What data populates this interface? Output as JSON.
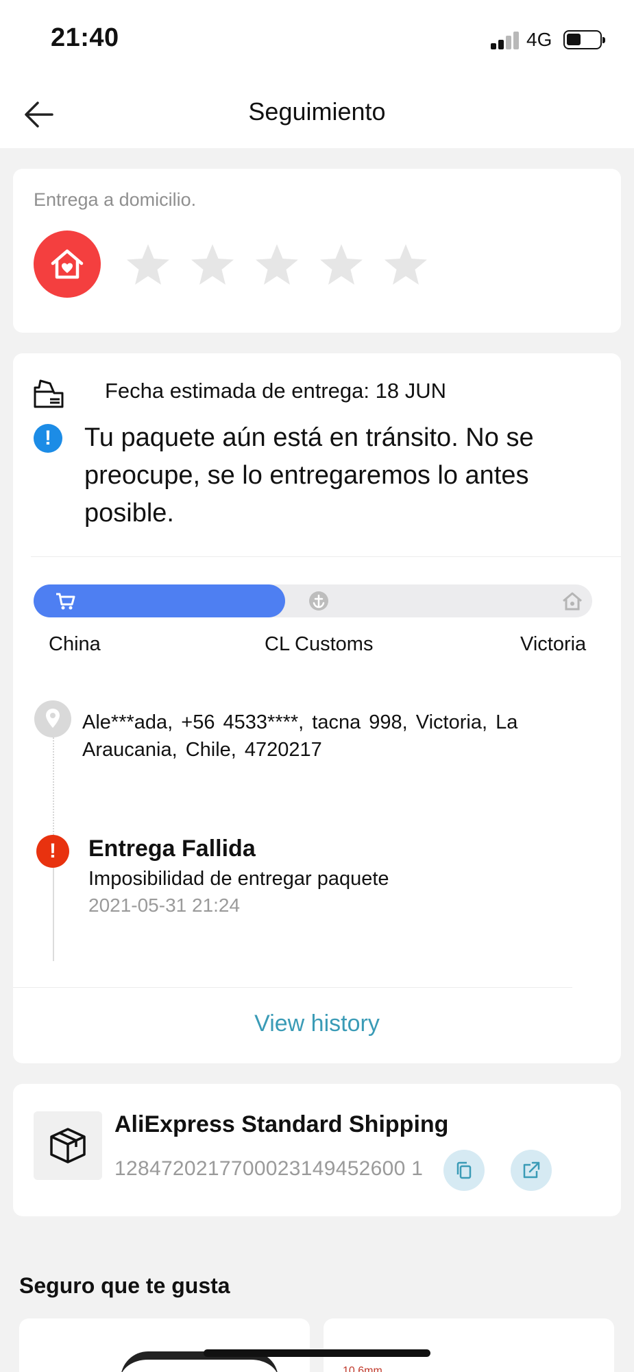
{
  "status_bar": {
    "time": "21:40",
    "network": "4G"
  },
  "header": {
    "title": "Seguimiento"
  },
  "delivery_card": {
    "label": "Entrega a domicilio.",
    "rating_max": 5,
    "rating_value": 0
  },
  "tracking_card": {
    "estimated_delivery": "Fecha estimada de entrega: 18 JUN",
    "transit_message": "Tu paquete aún está en tránsito. No se preocupe, se lo entregaremos lo antes posible.",
    "progress": {
      "fraction": 0.45,
      "steps": [
        {
          "label": "China",
          "icon": "cart-icon"
        },
        {
          "label": "CL Customs",
          "icon": "anchor-icon"
        },
        {
          "label": "Victoria",
          "icon": "home-icon"
        }
      ]
    },
    "address": "Ale***ada, +56 4533****, tacna 998, Victoria, La Araucania, Chile, 4720217",
    "latest_event": {
      "title": "Entrega Fallida",
      "description": "Imposibilidad de entregar paquete",
      "time": "2021-05-31 21:24"
    },
    "view_history_label": "View history"
  },
  "shipping_card": {
    "carrier": "AliExpress Standard Shipping",
    "tracking_number": "1284720217700023149452600 1"
  },
  "recommendations": {
    "title": "Seguro que te gusta",
    "tag": "10.6mm"
  },
  "colors": {
    "accent_blue": "#4e7ff2",
    "alert_red": "#e8320f",
    "home_red": "#f43f3f",
    "link_blue": "#3a9bb6"
  }
}
